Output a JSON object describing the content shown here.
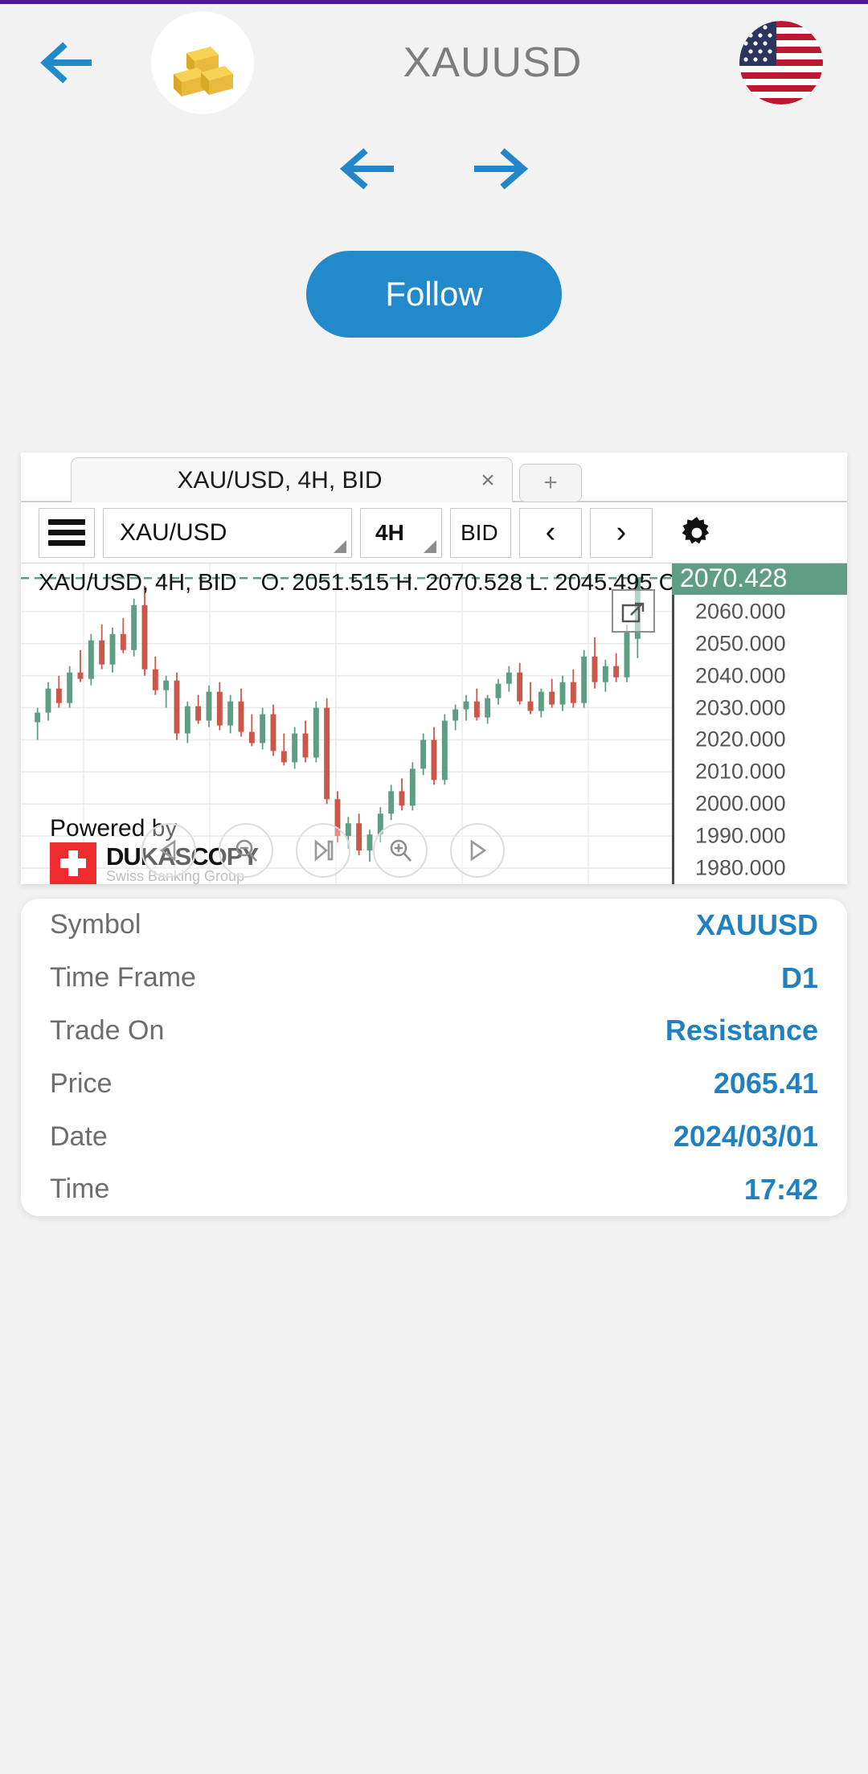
{
  "header": {
    "back_icon": "arrow-left-icon",
    "instrument_icon": "gold-bars-icon",
    "title": "XAUUSD",
    "flag_icon": "us-flag-icon"
  },
  "nav": {
    "prev_icon": "arrow-left-icon",
    "next_icon": "arrow-right-icon"
  },
  "follow": {
    "label": "Follow"
  },
  "chart": {
    "tab": {
      "label": "XAU/USD, 4H, BID",
      "close": "×",
      "add": "+"
    },
    "toolbar": {
      "menu_icon": "hamburger-icon",
      "symbol": "XAU/USD",
      "timeframe": "4H",
      "side": "BID",
      "prev": "‹",
      "next": "›",
      "settings_icon": "gear-icon"
    },
    "info": {
      "symbol_line": "XAU/USD, 4H, BID",
      "ohlc": "O. 2051.515 H. 2070.528 L. 2045.495 C"
    },
    "current_price": "2070.428",
    "expand_icon": "expand-icon",
    "watermark": {
      "powered_by": "Powered by",
      "brand": "DUKASCOPY",
      "tagline": "Swiss Banking Group"
    },
    "playback": [
      {
        "name": "step-back-button",
        "icon": "triangle-left-icon"
      },
      {
        "name": "zoom-out-button",
        "icon": "magnifier-minus-icon"
      },
      {
        "name": "step-forward-button",
        "icon": "play-to-end-icon"
      },
      {
        "name": "zoom-in-button",
        "icon": "magnifier-plus-icon"
      },
      {
        "name": "play-button",
        "icon": "play-icon"
      }
    ]
  },
  "chart_data": {
    "type": "candlestick",
    "title": "XAU/USD, 4H, BID",
    "xlabel": "",
    "ylabel": "",
    "ylim": [
      1975,
      2075
    ],
    "yticks": [
      2060.0,
      2050.0,
      2040.0,
      2030.0,
      2020.0,
      2010.0,
      2000.0,
      1990.0,
      1980.0
    ],
    "ytick_labels": [
      "2060.000",
      "2050.000",
      "2040.000",
      "2030.000",
      "2020.000",
      "2010.000",
      "2000.000",
      "1990.000",
      "1980.000"
    ],
    "grid": true,
    "last_price": 2070.428,
    "last_price_line": true,
    "ohlc_summary": {
      "open": 2051.515,
      "high": 2070.528,
      "low": 2045.495
    },
    "colors": {
      "up": "#5f9e85",
      "down": "#c9584a"
    },
    "candles": [
      {
        "o": 2025.5,
        "h": 2030.0,
        "l": 2020.0,
        "c": 2028.5
      },
      {
        "o": 2028.5,
        "h": 2038.0,
        "l": 2026.0,
        "c": 2036.0
      },
      {
        "o": 2036.0,
        "h": 2040.0,
        "l": 2030.0,
        "c": 2031.5
      },
      {
        "o": 2031.5,
        "h": 2043.0,
        "l": 2030.0,
        "c": 2041.0
      },
      {
        "o": 2041.0,
        "h": 2048.0,
        "l": 2038.0,
        "c": 2039.0
      },
      {
        "o": 2039.0,
        "h": 2053.0,
        "l": 2037.0,
        "c": 2051.0
      },
      {
        "o": 2051.0,
        "h": 2056.0,
        "l": 2042.0,
        "c": 2043.5
      },
      {
        "o": 2043.5,
        "h": 2055.0,
        "l": 2041.0,
        "c": 2053.0
      },
      {
        "o": 2053.0,
        "h": 2058.0,
        "l": 2047.0,
        "c": 2048.0
      },
      {
        "o": 2048.0,
        "h": 2064.0,
        "l": 2046.0,
        "c": 2062.0
      },
      {
        "o": 2062.0,
        "h": 2068.0,
        "l": 2040.0,
        "c": 2042.0
      },
      {
        "o": 2042.0,
        "h": 2046.0,
        "l": 2034.0,
        "c": 2035.5
      },
      {
        "o": 2035.5,
        "h": 2040.0,
        "l": 2030.0,
        "c": 2038.5
      },
      {
        "o": 2038.5,
        "h": 2041.0,
        "l": 2020.0,
        "c": 2022.0
      },
      {
        "o": 2022.0,
        "h": 2032.0,
        "l": 2019.0,
        "c": 2030.5
      },
      {
        "o": 2030.5,
        "h": 2034.0,
        "l": 2025.0,
        "c": 2026.0
      },
      {
        "o": 2026.0,
        "h": 2037.0,
        "l": 2024.0,
        "c": 2035.0
      },
      {
        "o": 2035.0,
        "h": 2038.0,
        "l": 2023.0,
        "c": 2024.5
      },
      {
        "o": 2024.5,
        "h": 2034.0,
        "l": 2022.0,
        "c": 2032.0
      },
      {
        "o": 2032.0,
        "h": 2036.0,
        "l": 2021.0,
        "c": 2022.5
      },
      {
        "o": 2022.5,
        "h": 2028.0,
        "l": 2018.0,
        "c": 2019.0
      },
      {
        "o": 2019.0,
        "h": 2030.0,
        "l": 2017.0,
        "c": 2028.0
      },
      {
        "o": 2028.0,
        "h": 2031.0,
        "l": 2015.0,
        "c": 2016.5
      },
      {
        "o": 2016.5,
        "h": 2022.0,
        "l": 2012.0,
        "c": 2013.0
      },
      {
        "o": 2013.0,
        "h": 2024.0,
        "l": 2011.0,
        "c": 2022.0
      },
      {
        "o": 2022.0,
        "h": 2026.0,
        "l": 2013.0,
        "c": 2014.5
      },
      {
        "o": 2014.5,
        "h": 2032.0,
        "l": 2013.0,
        "c": 2030.0
      },
      {
        "o": 2030.0,
        "h": 2033.0,
        "l": 2000.0,
        "c": 2001.5
      },
      {
        "o": 2001.5,
        "h": 2004.0,
        "l": 1988.0,
        "c": 1990.0
      },
      {
        "o": 1990.0,
        "h": 1996.0,
        "l": 1986.0,
        "c": 1994.0
      },
      {
        "o": 1994.0,
        "h": 1997.0,
        "l": 1984.0,
        "c": 1985.5
      },
      {
        "o": 1985.5,
        "h": 1992.0,
        "l": 1982.0,
        "c": 1990.5
      },
      {
        "o": 1990.5,
        "h": 1999.0,
        "l": 1988.0,
        "c": 1997.0
      },
      {
        "o": 1997.0,
        "h": 2006.0,
        "l": 1995.0,
        "c": 2004.0
      },
      {
        "o": 2004.0,
        "h": 2008.0,
        "l": 1998.0,
        "c": 1999.5
      },
      {
        "o": 1999.5,
        "h": 2013.0,
        "l": 1998.0,
        "c": 2011.0
      },
      {
        "o": 2011.0,
        "h": 2022.0,
        "l": 2009.0,
        "c": 2020.0
      },
      {
        "o": 2020.0,
        "h": 2024.0,
        "l": 2006.0,
        "c": 2007.5
      },
      {
        "o": 2007.5,
        "h": 2028.0,
        "l": 2006.0,
        "c": 2026.0
      },
      {
        "o": 2026.0,
        "h": 2031.0,
        "l": 2023.0,
        "c": 2029.5
      },
      {
        "o": 2029.5,
        "h": 2034.0,
        "l": 2026.0,
        "c": 2032.0
      },
      {
        "o": 2032.0,
        "h": 2036.0,
        "l": 2026.0,
        "c": 2027.0
      },
      {
        "o": 2027.0,
        "h": 2034.0,
        "l": 2025.0,
        "c": 2033.0
      },
      {
        "o": 2033.0,
        "h": 2039.0,
        "l": 2031.0,
        "c": 2037.5
      },
      {
        "o": 2037.5,
        "h": 2043.0,
        "l": 2035.0,
        "c": 2041.0
      },
      {
        "o": 2041.0,
        "h": 2044.0,
        "l": 2031.0,
        "c": 2032.0
      },
      {
        "o": 2032.0,
        "h": 2038.0,
        "l": 2028.0,
        "c": 2029.0
      },
      {
        "o": 2029.0,
        "h": 2036.0,
        "l": 2027.0,
        "c": 2035.0
      },
      {
        "o": 2035.0,
        "h": 2039.0,
        "l": 2030.0,
        "c": 2031.0
      },
      {
        "o": 2031.0,
        "h": 2040.0,
        "l": 2029.0,
        "c": 2038.0
      },
      {
        "o": 2038.0,
        "h": 2042.0,
        "l": 2030.0,
        "c": 2031.5
      },
      {
        "o": 2031.5,
        "h": 2048.0,
        "l": 2030.0,
        "c": 2046.0
      },
      {
        "o": 2046.0,
        "h": 2052.0,
        "l": 2036.0,
        "c": 2038.0
      },
      {
        "o": 2038.0,
        "h": 2045.0,
        "l": 2035.0,
        "c": 2043.0
      },
      {
        "o": 2043.0,
        "h": 2047.0,
        "l": 2038.0,
        "c": 2039.5
      },
      {
        "o": 2039.5,
        "h": 2056.0,
        "l": 2038.0,
        "c": 2054.0
      },
      {
        "o": 2051.5,
        "h": 2070.5,
        "l": 2045.5,
        "c": 2070.4
      }
    ]
  },
  "details": {
    "rows": [
      {
        "label": "Symbol",
        "value": "XAUUSD"
      },
      {
        "label": "Time Frame",
        "value": "D1"
      },
      {
        "label": "Trade On",
        "value": "Resistance"
      },
      {
        "label": "Price",
        "value": "2065.41"
      },
      {
        "label": "Date",
        "value": "2024/03/01"
      },
      {
        "label": "Time",
        "value": "17:42"
      }
    ]
  },
  "colors": {
    "accent": "#2289ca",
    "page_bg": "#f2f2f2",
    "up": "#5f9e85",
    "down": "#c9584a"
  }
}
